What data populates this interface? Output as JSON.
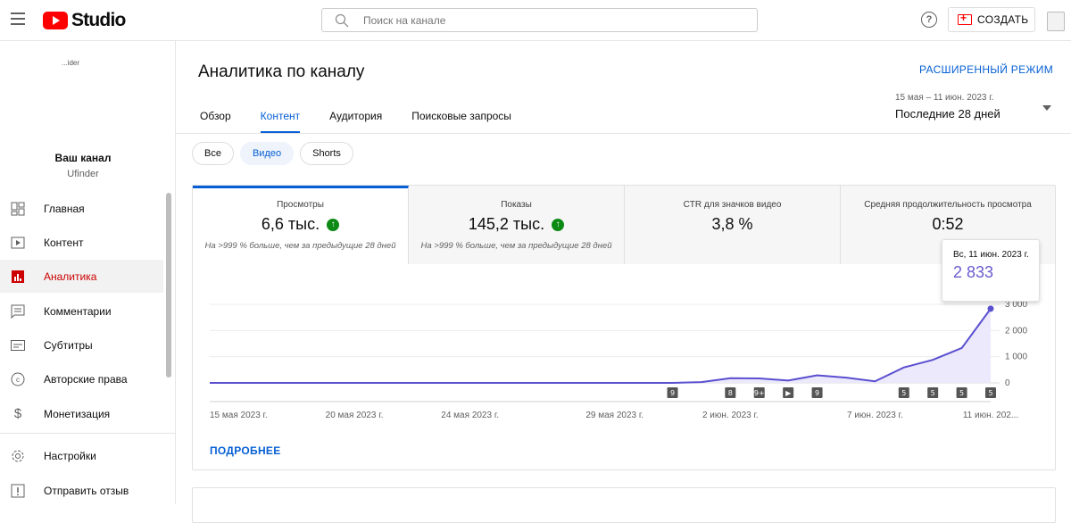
{
  "header": {
    "logo_text": "Studio",
    "search_placeholder": "Поиск на канале",
    "help_label": "?",
    "create_label": "СОЗДАТЬ"
  },
  "sidebar": {
    "channel_thumb_text": "...ider",
    "channel_title": "Ваш канал",
    "channel_name": "Ufinder",
    "items": [
      {
        "label": "Главная",
        "icon": "dashboard-icon"
      },
      {
        "label": "Контент",
        "icon": "content-icon"
      },
      {
        "label": "Аналитика",
        "icon": "analytics-icon",
        "active": true
      },
      {
        "label": "Комментарии",
        "icon": "comments-icon"
      },
      {
        "label": "Субтитры",
        "icon": "subtitles-icon"
      },
      {
        "label": "Авторские права",
        "icon": "copyright-icon"
      },
      {
        "label": "Монетизация",
        "icon": "monetization-icon"
      },
      {
        "label": "Настройки",
        "icon": "settings-icon"
      },
      {
        "label": "Отправить отзыв",
        "icon": "feedback-icon"
      }
    ]
  },
  "main": {
    "title": "Аналитика по каналу",
    "advanced_mode": "РАСШИРЕННЫЙ РЕЖИМ",
    "tabs": [
      {
        "label": "Обзор"
      },
      {
        "label": "Контент",
        "active": true
      },
      {
        "label": "Аудитория"
      },
      {
        "label": "Поисковые запросы"
      }
    ],
    "date_range": "15 мая – 11 июн. 2023 г.",
    "period": "Последние 28 дней",
    "chips": [
      {
        "label": "Все"
      },
      {
        "label": "Видео",
        "active": true
      },
      {
        "label": "Shorts"
      }
    ],
    "metrics": [
      {
        "label": "Просмотры",
        "value": "6,6 тыс.",
        "note": "На >999 % больше, чем за предыдущие 28 дней",
        "active": true
      },
      {
        "label": "Показы",
        "value": "145,2 тыс.",
        "note": "На >999 % больше, чем за предыдущие 28 дней"
      },
      {
        "label": "CTR для значков видео",
        "value": "3,8 %",
        "note": ""
      },
      {
        "label": "Средняя продолжительность просмотра",
        "value": "0:52",
        "note": ""
      }
    ],
    "more_label": "ПОДРОБНЕЕ"
  },
  "tooltip": {
    "date": "Вс, 11 июн. 2023 г.",
    "value": "2 833"
  },
  "colors": {
    "accent": "#065fd4",
    "line": "#5a4fcf",
    "area": "#ebe9fb",
    "brand": "#ff0000",
    "positive": "#0c8a14"
  },
  "chart_data": {
    "type": "area",
    "x": [
      "15 мая",
      "16 мая",
      "17 мая",
      "18 мая",
      "19 мая",
      "20 мая",
      "21 мая",
      "22 мая",
      "23 мая",
      "24 мая",
      "25 мая",
      "26 мая",
      "27 мая",
      "28 мая",
      "29 мая",
      "30 мая",
      "31 мая",
      "1 июн.",
      "2 июн.",
      "3 июн.",
      "4 июн.",
      "5 июн.",
      "6 июн.",
      "7 июн.",
      "8 июн.",
      "9 июн.",
      "10 июн.",
      "11 июн."
    ],
    "series": [
      {
        "values": [
          0,
          0,
          0,
          0,
          0,
          0,
          0,
          0,
          0,
          0,
          0,
          0,
          0,
          0,
          0,
          0,
          0,
          30,
          180,
          170,
          90,
          290,
          200,
          60,
          590,
          880,
          1330,
          2833
        ]
      }
    ],
    "xticks": [
      "15 мая 2023 г.",
      "20 мая 2023 г.",
      "24 мая 2023 г.",
      "29 мая 2023 г.",
      "2 июн. 2023 г.",
      "7 июн. 2023 г.",
      "11 июн. 202..."
    ],
    "xtick_index": [
      0,
      5,
      9,
      14,
      18,
      23,
      27
    ],
    "yticks": [
      "0",
      "1 000",
      "2 000",
      "3 000"
    ],
    "ylim": [
      0,
      3000
    ],
    "markers": [
      {
        "index": 16,
        "label": "9"
      },
      {
        "index": 18,
        "label": "8"
      },
      {
        "index": 19,
        "label": "9+"
      },
      {
        "index": 20,
        "label": "▶"
      },
      {
        "index": 21,
        "label": "9"
      },
      {
        "index": 24,
        "label": "5"
      },
      {
        "index": 25,
        "label": "5"
      },
      {
        "index": 26,
        "label": "5"
      },
      {
        "index": 27,
        "label": "5"
      }
    ],
    "grid": true
  }
}
